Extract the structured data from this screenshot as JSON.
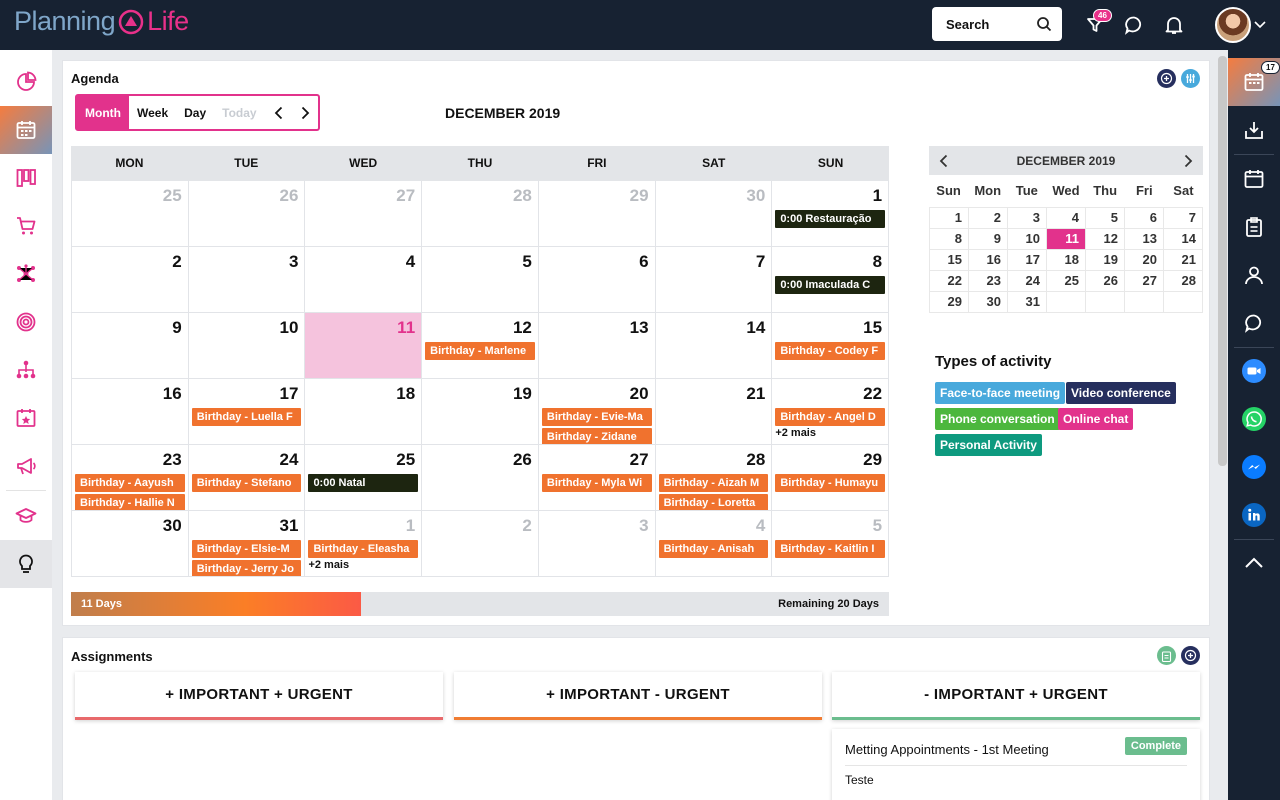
{
  "app": {
    "logo_left": "Planning",
    "logo_right": "Life"
  },
  "topbar": {
    "search_label": "Search",
    "filter_badge": "46"
  },
  "right_sidebar": {
    "calendar_badge": "17"
  },
  "agenda": {
    "title": "Agenda",
    "views": [
      "Month",
      "Week",
      "Day",
      "Today"
    ],
    "active_view": "Month",
    "month_title": "DECEMBER 2019",
    "weekday_headers": [
      "MON",
      "TUE",
      "WED",
      "THU",
      "FRI",
      "SAT",
      "SUN"
    ],
    "weeks": [
      [
        {
          "day": "25",
          "muted": true,
          "events": []
        },
        {
          "day": "26",
          "muted": true,
          "events": []
        },
        {
          "day": "27",
          "muted": true,
          "events": []
        },
        {
          "day": "28",
          "muted": true,
          "events": []
        },
        {
          "day": "29",
          "muted": true,
          "events": []
        },
        {
          "day": "30",
          "muted": true,
          "events": []
        },
        {
          "day": "1",
          "events": [
            {
              "label": "0:00   Restauração",
              "kind": "dark"
            }
          ]
        }
      ],
      [
        {
          "day": "2",
          "events": []
        },
        {
          "day": "3",
          "events": []
        },
        {
          "day": "4",
          "events": []
        },
        {
          "day": "5",
          "events": []
        },
        {
          "day": "6",
          "events": []
        },
        {
          "day": "7",
          "events": []
        },
        {
          "day": "8",
          "events": [
            {
              "label": "0:00   Imaculada C",
              "kind": "dark"
            }
          ]
        }
      ],
      [
        {
          "day": "9",
          "events": []
        },
        {
          "day": "10",
          "events": []
        },
        {
          "day": "11",
          "today": true,
          "events": []
        },
        {
          "day": "12",
          "events": [
            {
              "label": "Birthday - Marlene",
              "kind": "orange"
            }
          ]
        },
        {
          "day": "13",
          "events": []
        },
        {
          "day": "14",
          "events": []
        },
        {
          "day": "15",
          "events": [
            {
              "label": "Birthday - Codey F",
              "kind": "orange"
            }
          ]
        }
      ],
      [
        {
          "day": "16",
          "events": []
        },
        {
          "day": "17",
          "events": [
            {
              "label": "Birthday - Luella F",
              "kind": "orange"
            }
          ]
        },
        {
          "day": "18",
          "events": []
        },
        {
          "day": "19",
          "events": []
        },
        {
          "day": "20",
          "events": [
            {
              "label": "Birthday - Evie-Ma",
              "kind": "orange"
            },
            {
              "label": "Birthday - Zidane",
              "kind": "orange"
            }
          ]
        },
        {
          "day": "21",
          "events": []
        },
        {
          "day": "22",
          "events": [
            {
              "label": "Birthday - Angel D",
              "kind": "orange"
            }
          ],
          "more": "+2 mais"
        }
      ],
      [
        {
          "day": "23",
          "events": [
            {
              "label": "Birthday - Aayush",
              "kind": "orange"
            },
            {
              "label": "Birthday - Hallie N",
              "kind": "orange"
            }
          ]
        },
        {
          "day": "24",
          "events": [
            {
              "label": "Birthday - Stefano",
              "kind": "orange"
            }
          ]
        },
        {
          "day": "25",
          "events": [
            {
              "label": "0:00   Natal",
              "kind": "dark"
            }
          ]
        },
        {
          "day": "26",
          "events": []
        },
        {
          "day": "27",
          "events": [
            {
              "label": "Birthday - Myla Wi",
              "kind": "orange"
            }
          ]
        },
        {
          "day": "28",
          "events": [
            {
              "label": "Birthday - Aizah M",
              "kind": "orange"
            },
            {
              "label": "Birthday - Loretta",
              "kind": "orange"
            }
          ]
        },
        {
          "day": "29",
          "events": [
            {
              "label": "Birthday - Humayu",
              "kind": "orange"
            }
          ]
        }
      ],
      [
        {
          "day": "30",
          "events": []
        },
        {
          "day": "31",
          "events": [
            {
              "label": "Birthday - Elsie-M",
              "kind": "orange"
            },
            {
              "label": "Birthday - Jerry Jo",
              "kind": "orange"
            }
          ]
        },
        {
          "day": "1",
          "muted": true,
          "events": [
            {
              "label": "Birthday - Eleasha",
              "kind": "orange"
            }
          ],
          "more": "+2 mais"
        },
        {
          "day": "2",
          "muted": true,
          "events": []
        },
        {
          "day": "3",
          "muted": true,
          "events": []
        },
        {
          "day": "4",
          "muted": true,
          "events": [
            {
              "label": "Birthday - Anisah",
              "kind": "orange"
            }
          ]
        },
        {
          "day": "5",
          "muted": true,
          "events": [
            {
              "label": "Birthday - Kaitlin I",
              "kind": "orange"
            }
          ]
        }
      ]
    ],
    "progress": {
      "elapsed_label": "11 Days",
      "remaining_label": "Remaining 20 Days",
      "fraction": 0.355
    }
  },
  "mini_calendar": {
    "title": "DECEMBER 2019",
    "weekdays": [
      "Sun",
      "Mon",
      "Tue",
      "Wed",
      "Thu",
      "Fri",
      "Sat"
    ],
    "weeks": [
      [
        "1",
        "2",
        "3",
        "4",
        "5",
        "6",
        "7"
      ],
      [
        "8",
        "9",
        "10",
        "11",
        "12",
        "13",
        "14"
      ],
      [
        "15",
        "16",
        "17",
        "18",
        "19",
        "20",
        "21"
      ],
      [
        "22",
        "23",
        "24",
        "25",
        "26",
        "27",
        "28"
      ],
      [
        "29",
        "30",
        "31",
        "",
        "",
        "",
        ""
      ]
    ],
    "selected": "11"
  },
  "activity_types": {
    "title": "Types of activity",
    "items": [
      {
        "label": "Face-to-face meeting",
        "bg": "#48a9dc",
        "fg": "#ffffff"
      },
      {
        "label": "Video conference",
        "bg": "#262f5e",
        "fg": "#ffffff"
      },
      {
        "label": "Phone conversation",
        "bg": "#4cb73d",
        "fg": "#ffffff"
      },
      {
        "label": "Online chat",
        "bg": "#e2328c",
        "fg": "#ffffff"
      },
      {
        "label": "Personal Activity",
        "bg": "#0e9a7f",
        "fg": "#ffffff"
      }
    ]
  },
  "assignments": {
    "title": "Assignments",
    "quadrants": [
      {
        "label": "+ IMPORTANT + URGENT",
        "color": "#e8696b"
      },
      {
        "label": "+ IMPORTANT - URGENT",
        "color": "#f07c32"
      },
      {
        "label": "- IMPORTANT + URGENT",
        "color": "#6bbd8e"
      }
    ],
    "card": {
      "title": "Metting Appointments - 1st Meeting",
      "status": "Complete",
      "subtitle": "Teste"
    }
  },
  "colors": {
    "accent": "#e2328c",
    "topbar": "#172232",
    "event_orange": "#f0722e",
    "event_dark": "#1d2510"
  }
}
